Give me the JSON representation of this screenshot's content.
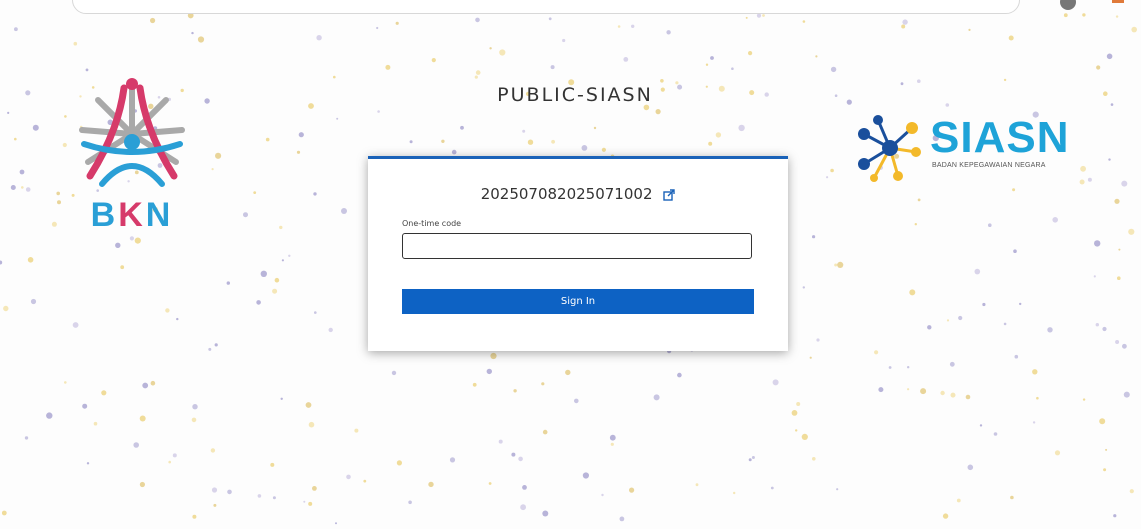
{
  "realm_title": "PUBLIC-SIASN",
  "bkn_logo": {
    "text_b": "B",
    "text_k": "K",
    "text_n": "N"
  },
  "siasn_logo": {
    "word": "SIASN",
    "tagline": "BADAN KEPEGAWAIAN NEGARA"
  },
  "login": {
    "username": "202507082025071002",
    "otp_label": "One-time code",
    "otp_value": "",
    "submit_label": "Sign In"
  },
  "colors": {
    "primary": "#0d62c4",
    "card_border": "#1a62b8",
    "bkn_blue": "#2a9fd6",
    "bkn_red": "#d63a6a",
    "siasn_blue": "#1ea3d8",
    "siasn_yellow": "#f3b92a"
  }
}
